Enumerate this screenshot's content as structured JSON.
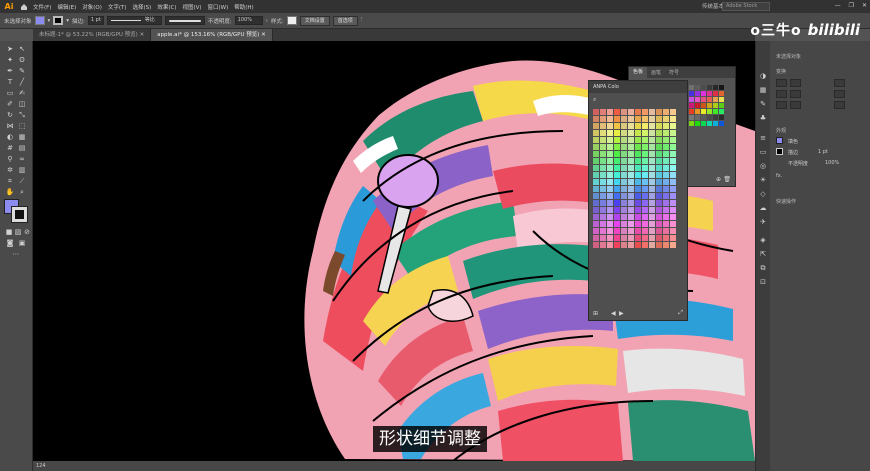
{
  "app": {
    "logo": "Ai",
    "menus": [
      "文件(F)",
      "编辑(E)",
      "对象(O)",
      "文字(T)",
      "选择(S)",
      "效果(C)",
      "视图(V)",
      "窗口(W)",
      "帮助(H)"
    ],
    "workspace": "传统基本功能",
    "search_placeholder": "Adobe Stock",
    "window_buttons": [
      "—",
      "❐",
      "✕"
    ]
  },
  "control_bar": {
    "selection_label": "未选择对象",
    "stroke_label": "描边:",
    "stroke_value": "1 pt",
    "uniform_label": "等比",
    "opacity_label": "不透明度:",
    "opacity_value": "100%",
    "style_label": "样式:",
    "doc_setup": "文档设置",
    "preferences": "首选项",
    "fill_color": "#8b8bf0",
    "stroke_color": "#000000"
  },
  "tabs": [
    {
      "label": "未标题-1* @ 53.22% (RGB/GPU 预览)"
    },
    {
      "label": "apple.ai* @ 153.16% (RGB/GPU 预览)"
    }
  ],
  "status": {
    "zoom": "124"
  },
  "properties": {
    "header": "未选择对象",
    "transform": "变换",
    "appearance": "外观",
    "fill_label": "填色",
    "stroke_label": "描边",
    "stroke_value": "1 pt",
    "opacity_label": "不透明度",
    "opacity_value": "100%",
    "fx": "fx.",
    "quick_actions": "快速操作"
  },
  "swatches_panel": {
    "tabs": [
      "色板",
      "画笔",
      "符号"
    ]
  },
  "anpa_panel": {
    "title": "ANPA Colo"
  },
  "subtitle": "形状细节调整",
  "watermark": {
    "name": "o三牛o",
    "site": "bilibili"
  },
  "colors": {
    "canvas": "#000000",
    "ui_dark": "#323232",
    "ui_mid": "#535353",
    "logo": "#ff9a00",
    "fill_swatch": "#8b8bf0"
  }
}
